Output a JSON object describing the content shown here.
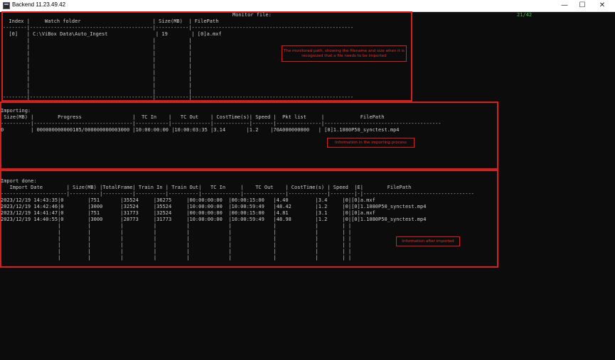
{
  "window": {
    "title": "Backend 11.23.49.42",
    "minimize_glyph": "—",
    "maximize_glyph": "☐",
    "close_glyph": "✕"
  },
  "counter": "21/42",
  "monitor": {
    "heading": "Monitor file:",
    "header_line": "  Index |     Watch folder                        | Size(MB)  | FilePath",
    "separator": "--------|-----------------------------------------|-----------|------------------------------------------------------",
    "rows": [
      "  [0]   | C:\\ViBox Data\\Auto_Ingest                | 19        | [0]a.mxf",
      "        |                                         |           |",
      "        |                                         |           |",
      "        |                                         |           |",
      "        |                                         |           |",
      "        |                                         |           |",
      "        |                                         |           |",
      "        |                                         |           |",
      "        |                                         |           |",
      "        |                                         |           |"
    ],
    "footer": "--------|-----------------------------------------|-----------|------------------------------------------------------",
    "callout": "The monitored path, showing the filename and size when it is recognized that a file needs to be imported"
  },
  "importing": {
    "heading": "Importing:",
    "header_line": " Size(MB) |        Progress                 |  TC In    |   TC Out    | CostTime(s)| Speed |  Pkt list     |            FilePath",
    "separator": "----------|---------------------------------|-----------|-------------|------------|-------|---------------|---------------------------------------",
    "row": "0         | 000000000000185/000000000003000 |10:00:00:00 |10:00:03:35 |3.14       |1.2    |70A000000000   | [0]1.1080P50_synctest.mp4",
    "callout": "Information in the importing process"
  },
  "done": {
    "heading": "Import done:",
    "header_line": "   Import Date        | Size(MB) |TotalFrame| Train In | Train Out|   TC In     |    TC Out    | CostTime(s) | Speed  |E|        FilePath",
    "separator": "----------------------|----------|----------|----------|----------|-------------|--------------|-------------|--------|-|-------------------------------------",
    "rows": [
      "2023/12/19 14:43:35|0        |751       |35524     |36275     |00:00:00:00  |00:00:15:00   |4.40         |3.4     |0|[0]a.mxf",
      "2023/12/19 14:42:46|0        |3000      |32524     |35524     |10:00:00:00  |10:00:59:49   |48.42        |1.2     |0|[0]1.1080P50_synctest.mp4",
      "2023/12/19 14:41:47|0        |751       |31773     |32524     |00:00:00:00  |00:00:15:00   |4.81         |3.1     |0|[0]a.mxf",
      "2023/12/19 14:40:55|0        |3000      |28773     |31773     |10:00:00:00  |10:00:59:49   |48.98        |1.2     |0|[0]1.1080P50_synctest.mp4",
      "                   |         |          |          |          |             |              |             |        | |",
      "                   |         |          |          |          |             |              |             |        | |",
      "                   |         |          |          |          |             |              |             |        | |",
      "                   |         |          |          |          |             |              |             |        | |",
      "                   |         |          |          |          |             |              |             |        | |",
      "                   |         |          |          |          |             |              |             |        | |"
    ],
    "callout": "Information after imported"
  }
}
